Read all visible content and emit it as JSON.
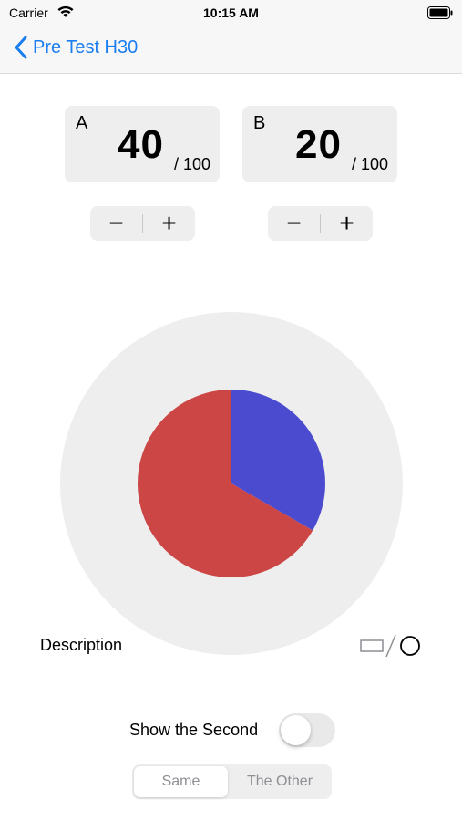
{
  "status_bar": {
    "carrier": "Carrier",
    "time": "10:15 AM"
  },
  "navbar": {
    "back_label": "Pre Test H30"
  },
  "scores": [
    {
      "letter": "A",
      "value": "40",
      "max": "/ 100"
    },
    {
      "letter": "B",
      "value": "20",
      "max": "/ 100"
    }
  ],
  "steppers": {
    "minus": "−",
    "plus": "+"
  },
  "chart_data": {
    "type": "pie",
    "values": [
      20,
      40
    ],
    "colors": [
      "#4b4bcf",
      "#cc4646"
    ],
    "background_color": "#eeeeee"
  },
  "description": {
    "label": "Description"
  },
  "toggle": {
    "label": "Show the Second",
    "on": false
  },
  "segment": {
    "options": [
      "Same",
      "The Other"
    ],
    "selected": 0
  },
  "colors": {
    "accent": "#1a7ef0",
    "track": "#e9e9ea"
  }
}
